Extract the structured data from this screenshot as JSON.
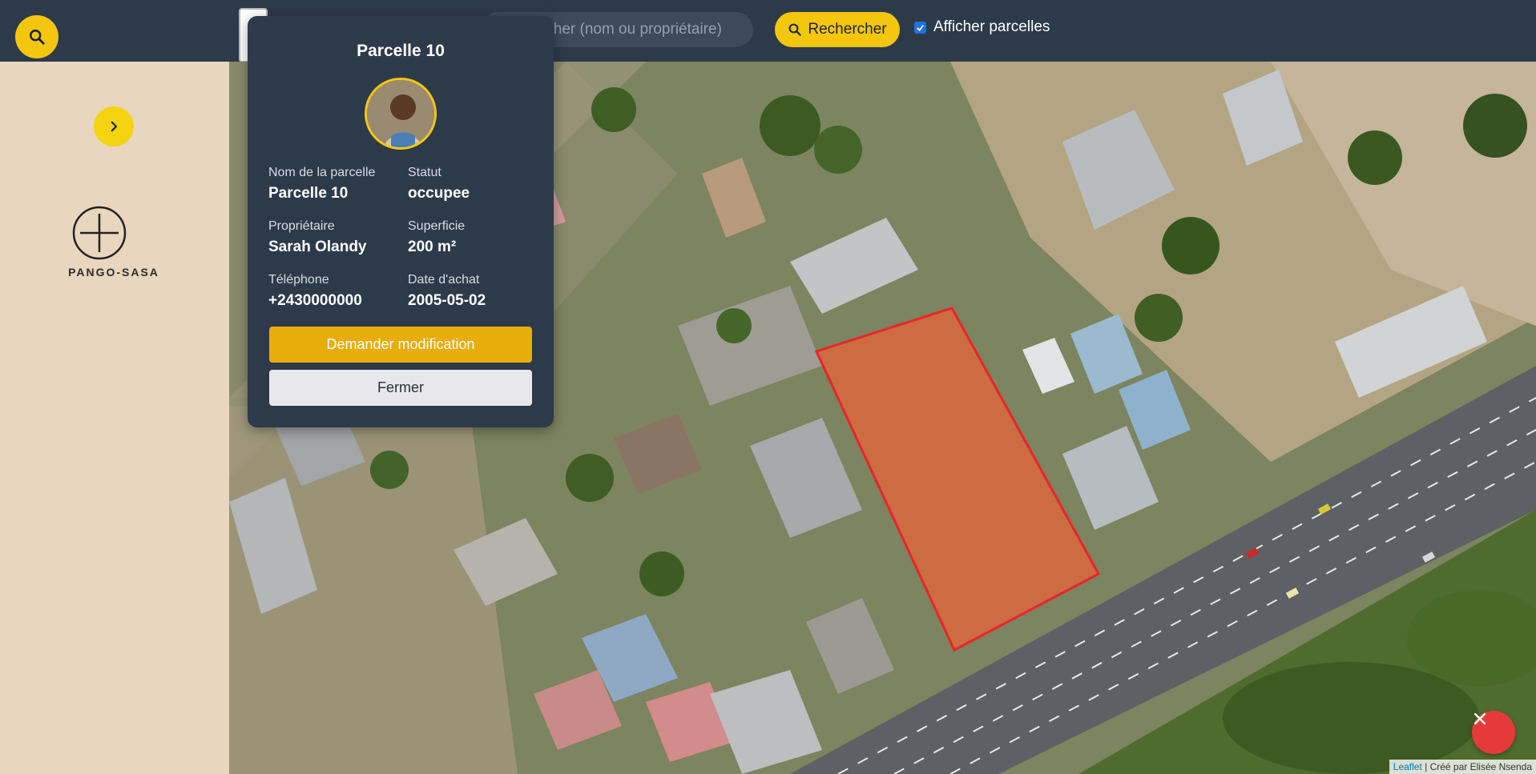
{
  "topbar": {
    "search_placeholder": "Rechercher (nom ou propriétaire)",
    "search_button_label": "Rechercher",
    "toggle_label": "Afficher parcelles",
    "toggle_checked": true
  },
  "sidebar": {
    "brand": "PANGO-SASA"
  },
  "popup": {
    "title": "Parcelle 10",
    "fields": {
      "name_label": "Nom de la parcelle",
      "name_value": "Parcelle 10",
      "status_label": "Statut",
      "status_value": "occupee",
      "owner_label": "Propriétaire",
      "owner_value": "Sarah Olandy",
      "area_label": "Superficie",
      "area_value": "200 m²",
      "phone_label": "Téléphone",
      "phone_value": "+2430000000",
      "date_label": "Date d'achat",
      "date_value": "2005-05-02"
    },
    "request_button": "Demander modification",
    "close_button": "Fermer"
  },
  "map": {
    "attribution_link": "Leaflet",
    "attribution_text": "| Créé par Elisée Nsenda"
  },
  "colors": {
    "accent": "#f4c60e",
    "topbar": "#2d3a4a",
    "parcel_fill": "#e8643a",
    "parcel_stroke": "#e8252a",
    "danger": "#e63a3a"
  },
  "icons": {
    "top_search": "search-icon",
    "expand": "chevron-right-icon",
    "logo": "crosshair-circle-icon",
    "close": "close-icon"
  }
}
